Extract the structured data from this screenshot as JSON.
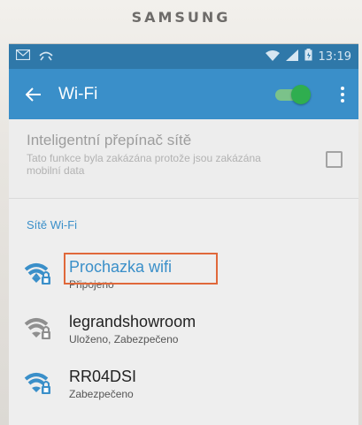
{
  "device": {
    "brand": "SAMSUNG"
  },
  "status_bar": {
    "time": "13:19"
  },
  "app_bar": {
    "title": "Wi-Fi",
    "wifi_enabled": true
  },
  "smart_switch": {
    "title": "Inteligentní přepínač sítě",
    "description": "Tato funkce byla zakázána protože jsou zakázána mobilní data",
    "checked": false
  },
  "section_header": "Sítě Wi-Fi",
  "networks": [
    {
      "name": "Prochazka wifi",
      "status": "Připojeno",
      "signal_color": "#3a8fc9"
    },
    {
      "name": "legrandshowroom",
      "status": "Uloženo, Zabezpečeno",
      "signal_color": "#8f8f8f"
    },
    {
      "name": "RR04DSI",
      "status": "Zabezpečeno",
      "signal_color": "#3a8fc9"
    }
  ],
  "colors": {
    "accent": "#3a8fc9",
    "highlight": "#e0683a",
    "switch_on": "#2fae4f"
  }
}
